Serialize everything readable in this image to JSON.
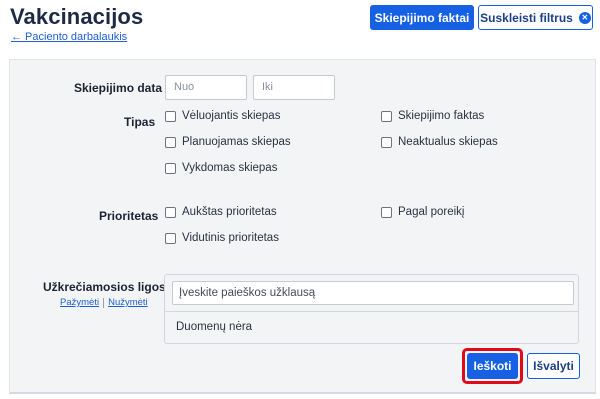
{
  "header": {
    "title": "Vakcinacijos",
    "back_link": "← Paciento darbalaukis",
    "primary_button": "Skiepijimo faktai",
    "collapse_button": "Suskleisti filtrus",
    "collapse_icon": "x-circle-icon"
  },
  "filters": {
    "date": {
      "label": "Skiepijimo data",
      "from_placeholder": "Nuo",
      "to_placeholder": "Iki"
    },
    "type": {
      "label": "Tipas",
      "options": [
        "Vėluojantis skiepas",
        "Skiepijimo faktas",
        "Planuojamas skiepas",
        "Neaktualus skiepas",
        "Vykdomas skiepas"
      ]
    },
    "priority": {
      "label": "Prioritetas",
      "options": [
        "Aukštas prioritetas",
        "Pagal poreikį",
        "Vidutinis prioritetas"
      ]
    },
    "diseases": {
      "label": "Užkrečiamosios ligos",
      "select_all": "Pažymėti",
      "deselect_all": "Nužymėti",
      "search_placeholder": "Įveskite paieškos užklausą",
      "empty_text": "Duomenų nėra"
    }
  },
  "actions": {
    "search": "Ieškoti",
    "clear": "Išvalyti"
  },
  "colors": {
    "accent": "#1560e3",
    "highlight": "#e00a1a",
    "panel": "#f3f4f6"
  }
}
